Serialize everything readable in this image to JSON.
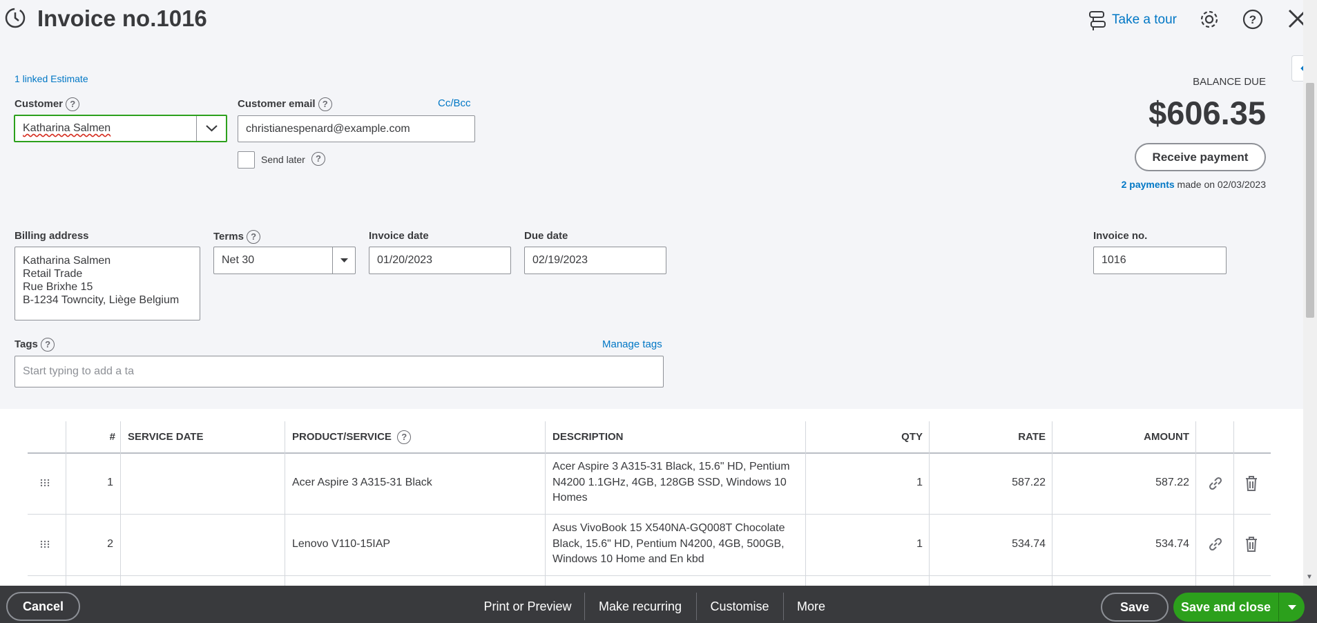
{
  "header": {
    "title": "Invoice no.1016",
    "take_tour": "Take a tour"
  },
  "linked_estimate": "1 linked Estimate",
  "customer": {
    "label": "Customer",
    "value": "Katharina Salmen"
  },
  "email": {
    "label": "Customer email",
    "value": "christianespenard@example.com",
    "cc_bcc": "Cc/Bcc",
    "send_later": "Send later"
  },
  "balance": {
    "label": "BALANCE DUE",
    "amount": "$606.35",
    "receive_payment": "Receive payment",
    "payments_link": "2 payments",
    "payments_text": "made on 02/03/2023"
  },
  "billing": {
    "label": "Billing address",
    "lines": [
      "Katharina Salmen",
      "Retail Trade",
      "Rue Brixhe 15",
      "B-1234 Towncity, Liège Belgium"
    ]
  },
  "terms": {
    "label": "Terms",
    "value": "Net 30"
  },
  "invoice_date": {
    "label": "Invoice date",
    "value": "01/20/2023"
  },
  "due_date": {
    "label": "Due date",
    "value": "02/19/2023"
  },
  "invoice_no": {
    "label": "Invoice no.",
    "value": "1016"
  },
  "tags": {
    "label": "Tags",
    "manage": "Manage tags",
    "placeholder": "Start typing to add a ta"
  },
  "table": {
    "headers": {
      "num": "#",
      "service_date": "SERVICE DATE",
      "product": "PRODUCT/SERVICE",
      "description": "DESCRIPTION",
      "qty": "QTY",
      "rate": "RATE",
      "amount": "AMOUNT"
    },
    "rows": [
      {
        "num": "1",
        "service_date": "",
        "product": "Acer Aspire 3 A315-31 Black",
        "description": [
          "Acer Aspire 3 A315-31 Black, 15.6\" HD, Pentium",
          "N4200 1.1GHz, 4GB, 128GB SSD, Windows 10",
          "Homes"
        ],
        "qty": "1",
        "rate": "587.22",
        "amount": "587.22"
      },
      {
        "num": "2",
        "service_date": "",
        "product": "Lenovo V110-15IAP",
        "description": [
          "Asus VivoBook 15 X540NA-GQ008T Chocolate",
          "Black, 15.6\" HD, Pentium N4200, 4GB, 500GB,",
          "Windows 10 Home and En kbd"
        ],
        "qty": "1",
        "rate": "534.74",
        "amount": "534.74"
      }
    ]
  },
  "footer": {
    "cancel": "Cancel",
    "print": "Print or Preview",
    "recurring": "Make recurring",
    "customise": "Customise",
    "more": "More",
    "save": "Save",
    "save_close": "Save and close"
  }
}
